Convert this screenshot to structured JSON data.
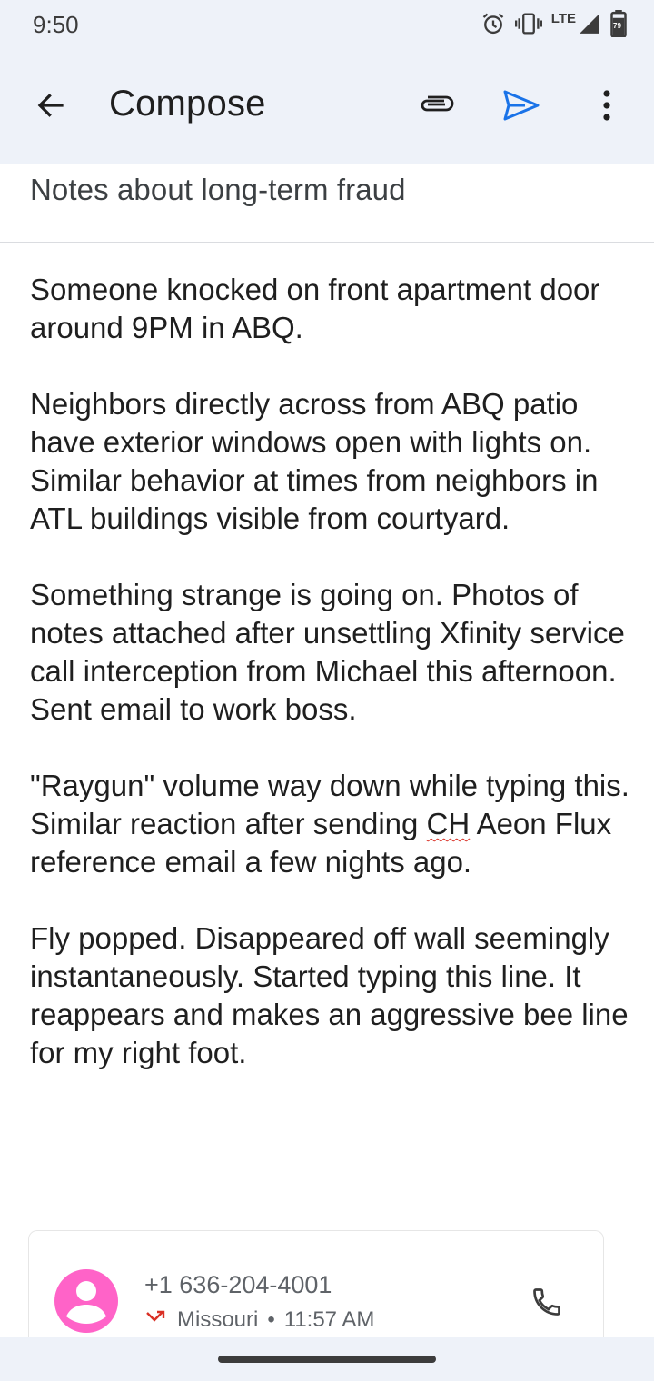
{
  "status_bar": {
    "time": "9:50",
    "network": "LTE",
    "battery_level": "79",
    "icons": [
      "alarm-icon",
      "vibrate-icon",
      "signal-icon",
      "battery-icon"
    ]
  },
  "app_bar": {
    "title": "Compose",
    "icons": [
      "back-arrow-icon",
      "paperclip-icon",
      "send-icon",
      "more-vert-icon"
    ],
    "send_color": "#1a73e8"
  },
  "subject": "Notes about long-term fraud",
  "body": {
    "paragraphs": [
      "Someone knocked on front apartment door around 9PM in ABQ.",
      "Neighbors directly across from ABQ patio have exterior windows open with lights on. Similar behavior at times from neighbors in ATL buildings visible from courtyard.",
      "Something strange is going on. Photos of notes attached after unsettling Xfinity service call interception from Michael this afternoon. Sent email to work boss.",
      "Raygun",
      "Fly popped. Disappeared off wall seemingly instantaneously. Started typing this line. It reappears and makes an aggressive bee line for my right foot."
    ],
    "p4_before": "\"Raygun\" volume way down while typing this. Similar reaction after sending ",
    "p4_misspelled": "CH",
    "p4_after": " Aeon Flux reference email a few nights ago."
  },
  "call_card": {
    "phone_number": "+1 636-204-4001",
    "location": "Missouri",
    "separator": "•",
    "time": "11:57 AM",
    "call_status": "missed",
    "avatar_color": "#ff63c8",
    "missed_color": "#d93025"
  }
}
